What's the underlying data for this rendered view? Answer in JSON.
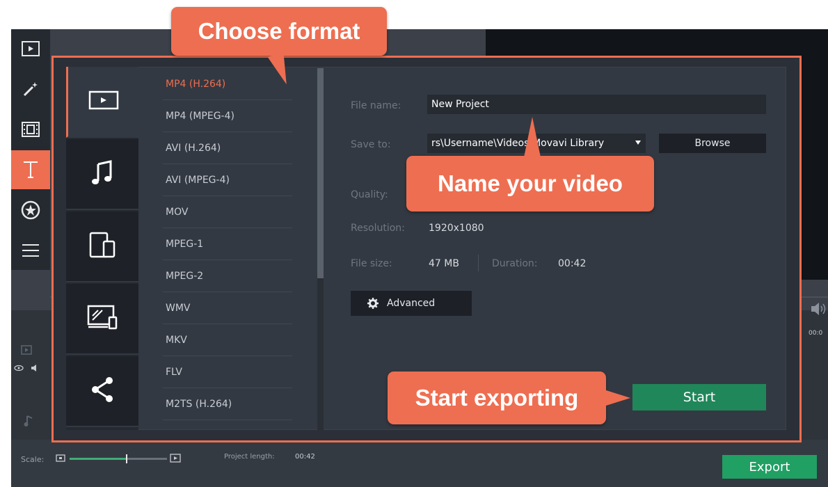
{
  "callouts": {
    "choose_format": "Choose format",
    "name_video": "Name your video",
    "start_exporting": "Start exporting"
  },
  "toolbar": {
    "items": [
      {
        "icon": "film-icon"
      },
      {
        "icon": "magic-wand-icon"
      },
      {
        "icon": "filmstrip-icon"
      },
      {
        "icon": "text-icon",
        "active": true
      },
      {
        "icon": "star-circle-icon"
      },
      {
        "icon": "list-icon"
      }
    ]
  },
  "categories": [
    {
      "icon": "video-icon",
      "active": true
    },
    {
      "icon": "music-icon"
    },
    {
      "icon": "devices-icon"
    },
    {
      "icon": "tv-icon"
    },
    {
      "icon": "share-icon"
    }
  ],
  "formats": [
    {
      "label": "MP4 (H.264)",
      "active": true
    },
    {
      "label": "MP4 (MPEG-4)"
    },
    {
      "label": "AVI (H.264)"
    },
    {
      "label": "AVI (MPEG-4)"
    },
    {
      "label": "MOV"
    },
    {
      "label": "MPEG-1"
    },
    {
      "label": "MPEG-2"
    },
    {
      "label": "WMV"
    },
    {
      "label": "MKV"
    },
    {
      "label": "FLV"
    },
    {
      "label": "M2TS (H.264)"
    }
  ],
  "form": {
    "file_name_label": "File name:",
    "file_name_value": "New Project",
    "save_to_label": "Save to:",
    "save_to_value": "rs\\Username\\Videos\\Movavi Library",
    "browse_label": "Browse",
    "quality_label": "Quality:",
    "resolution_label": "Resolution:",
    "resolution_value": "1920x1080",
    "file_size_label": "File size:",
    "file_size_value": "47 MB",
    "duration_label": "Duration:",
    "duration_value": "00:42",
    "advanced_label": "Advanced",
    "start_label": "Start"
  },
  "footer": {
    "scale_label": "Scale:",
    "scale_value": 0.58,
    "project_length_label": "Project length:",
    "project_length_value": "00:42",
    "export_label": "Export"
  },
  "timeline": {
    "time_mark": "00:0"
  },
  "colors": {
    "accent": "#ee6e51",
    "start_green": "#20875a",
    "export_green": "#20a063"
  }
}
